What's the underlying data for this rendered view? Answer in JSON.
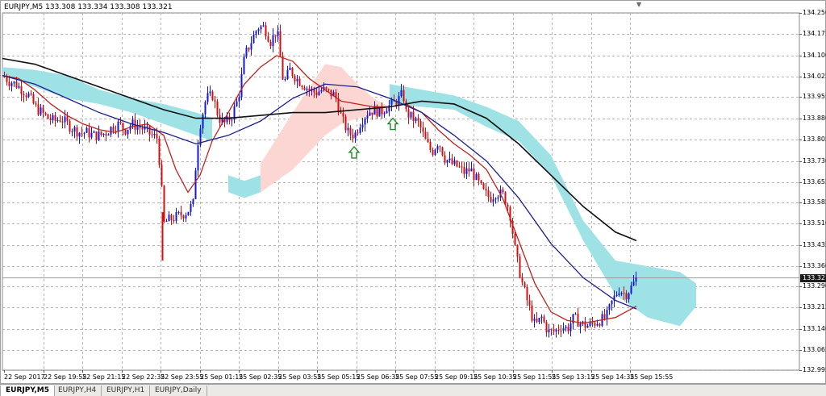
{
  "window": {
    "title": "EURJPY,M5  133.308 133.334 133.308 133.321"
  },
  "current_price": {
    "label": "133.321",
    "value": 133.321
  },
  "tabs": [
    {
      "label": "EURJPY,M5",
      "active": true
    },
    {
      "label": "EURJPY,H4",
      "active": false
    },
    {
      "label": "EURJPY,H1",
      "active": false
    },
    {
      "label": "EURJPY,Daily",
      "active": false
    }
  ],
  "colors": {
    "bull": "#1717d8",
    "bear": "#d01010",
    "ma_fast": "#c0221c",
    "ma_mid": "#1d1d8f",
    "ma_slow": "#101010",
    "cloud_bull": "#9fe2e6",
    "cloud_bear": "#fbd6d2",
    "grid": "#b4b4b4",
    "arrow": "#1e8a28"
  },
  "chart_data": {
    "type": "candlestick",
    "symbol": "EURJPY",
    "timeframe": "M5",
    "ohlc_header": {
      "open": 133.308,
      "high": 133.334,
      "low": 133.308,
      "close": 133.321
    },
    "ylim": [
      132.995,
      134.25
    ],
    "y_ticks": [
      "134.250",
      "134.175",
      "134.100",
      "134.025",
      "133.955",
      "133.880",
      "133.805",
      "133.730",
      "133.655",
      "133.585",
      "133.510",
      "133.435",
      "133.360",
      "133.290",
      "133.215",
      "133.140",
      "133.065",
      "132.995"
    ],
    "x_ticks": [
      "22 Sep 2017",
      "22 Sep 19:55",
      "22 Sep 21:15",
      "22 Sep 22:35",
      "22 Sep 23:55",
      "25 Sep 01:15",
      "25 Sep 02:35",
      "25 Sep 03:55",
      "25 Sep 05:15",
      "25 Sep 06:35",
      "25 Sep 07:55",
      "25 Sep 09:15",
      "25 Sep 10:35",
      "25 Sep 11:55",
      "25 Sep 13:15",
      "25 Sep 14:35",
      "25 Sep 15:55"
    ],
    "close_path": [
      [
        0,
        134.03
      ],
      [
        8,
        134.01
      ],
      [
        16,
        134.0
      ],
      [
        24,
        133.98
      ],
      [
        32,
        133.96
      ],
      [
        40,
        133.92
      ],
      [
        48,
        133.9
      ],
      [
        56,
        133.88
      ],
      [
        64,
        133.87
      ],
      [
        72,
        133.88
      ],
      [
        80,
        133.86
      ],
      [
        88,
        133.84
      ],
      [
        96,
        133.83
      ],
      [
        104,
        133.83
      ],
      [
        112,
        133.82
      ],
      [
        120,
        133.82
      ],
      [
        128,
        133.83
      ],
      [
        136,
        133.85
      ],
      [
        144,
        133.86
      ],
      [
        152,
        133.84
      ],
      [
        160,
        133.86
      ],
      [
        168,
        133.85
      ],
      [
        176,
        133.84
      ],
      [
        184,
        133.82
      ],
      [
        192,
        133.81
      ],
      [
        200,
        133.51
      ],
      [
        204,
        133.52
      ],
      [
        212,
        133.53
      ],
      [
        220,
        133.54
      ],
      [
        228,
        133.55
      ],
      [
        236,
        133.58
      ],
      [
        240,
        133.75
      ],
      [
        244,
        133.85
      ],
      [
        252,
        133.95
      ],
      [
        260,
        133.96
      ],
      [
        268,
        133.88
      ],
      [
        276,
        133.86
      ],
      [
        284,
        133.89
      ],
      [
        292,
        133.95
      ],
      [
        300,
        134.1
      ],
      [
        308,
        134.15
      ],
      [
        316,
        134.2
      ],
      [
        324,
        134.2
      ],
      [
        332,
        134.15
      ],
      [
        340,
        134.19
      ],
      [
        348,
        134.0
      ],
      [
        356,
        134.05
      ],
      [
        364,
        134.02
      ],
      [
        372,
        134.0
      ],
      [
        380,
        133.98
      ],
      [
        388,
        133.97
      ],
      [
        396,
        133.98
      ],
      [
        404,
        133.97
      ],
      [
        412,
        133.96
      ],
      [
        420,
        133.88
      ],
      [
        428,
        133.83
      ],
      [
        436,
        133.82
      ],
      [
        444,
        133.87
      ],
      [
        452,
        133.9
      ],
      [
        460,
        133.91
      ],
      [
        468,
        133.9
      ],
      [
        476,
        133.92
      ],
      [
        484,
        133.93
      ],
      [
        492,
        133.95
      ],
      [
        496,
        133.97
      ],
      [
        500,
        133.9
      ],
      [
        508,
        133.88
      ],
      [
        516,
        133.86
      ],
      [
        524,
        133.8
      ],
      [
        532,
        133.76
      ],
      [
        540,
        133.8
      ],
      [
        548,
        133.74
      ],
      [
        556,
        133.72
      ],
      [
        564,
        133.71
      ],
      [
        572,
        133.69
      ],
      [
        580,
        133.7
      ],
      [
        588,
        133.66
      ],
      [
        596,
        133.62
      ],
      [
        604,
        133.6
      ],
      [
        612,
        133.62
      ],
      [
        620,
        133.61
      ],
      [
        628,
        133.56
      ],
      [
        636,
        133.4
      ],
      [
        644,
        133.3
      ],
      [
        652,
        133.22
      ],
      [
        660,
        133.15
      ],
      [
        668,
        133.18
      ],
      [
        676,
        133.13
      ],
      [
        684,
        133.13
      ],
      [
        692,
        133.15
      ],
      [
        700,
        133.14
      ],
      [
        708,
        133.18
      ],
      [
        716,
        133.16
      ],
      [
        724,
        133.15
      ],
      [
        732,
        133.16
      ],
      [
        740,
        133.17
      ],
      [
        748,
        133.18
      ],
      [
        756,
        133.24
      ],
      [
        764,
        133.28
      ],
      [
        772,
        133.26
      ],
      [
        780,
        133.29
      ],
      [
        786,
        133.321
      ]
    ],
    "series": [
      {
        "name": "MA fast",
        "x": [
          0,
          20,
          40,
          60,
          80,
          100,
          120,
          140,
          160,
          180,
          200,
          215,
          230,
          245,
          260,
          280,
          300,
          320,
          340,
          360,
          380,
          400,
          420,
          440,
          460,
          480,
          500,
          520,
          540,
          560,
          580,
          600,
          620,
          640,
          660,
          680,
          700,
          720,
          740,
          760,
          786
        ],
        "values": [
          134.03,
          134.02,
          133.98,
          133.93,
          133.89,
          133.86,
          133.84,
          133.83,
          133.85,
          133.86,
          133.82,
          133.7,
          133.62,
          133.68,
          133.8,
          133.9,
          134.0,
          134.06,
          134.1,
          134.08,
          134.02,
          133.98,
          133.94,
          133.93,
          133.92,
          133.92,
          133.93,
          133.9,
          133.84,
          133.79,
          133.75,
          133.7,
          133.6,
          133.45,
          133.3,
          133.2,
          133.17,
          133.16,
          133.17,
          133.18,
          133.22
        ]
      },
      {
        "name": "MA mid",
        "x": [
          0,
          40,
          80,
          120,
          160,
          200,
          240,
          280,
          320,
          360,
          400,
          440,
          480,
          520,
          560,
          600,
          640,
          680,
          720,
          760,
          786
        ],
        "values": [
          134.03,
          134.0,
          133.95,
          133.9,
          133.86,
          133.83,
          133.79,
          133.82,
          133.87,
          133.95,
          134.0,
          133.99,
          133.95,
          133.9,
          133.82,
          133.73,
          133.6,
          133.44,
          133.32,
          133.24,
          133.21
        ]
      },
      {
        "name": "MA slow",
        "x": [
          0,
          40,
          80,
          120,
          160,
          200,
          240,
          280,
          320,
          360,
          400,
          440,
          480,
          520,
          560,
          600,
          640,
          680,
          720,
          760,
          786
        ],
        "values": [
          134.09,
          134.07,
          134.03,
          133.99,
          133.95,
          133.91,
          133.88,
          133.88,
          133.89,
          133.9,
          133.9,
          133.91,
          133.92,
          133.94,
          133.93,
          133.88,
          133.79,
          133.68,
          133.57,
          133.48,
          133.45
        ]
      }
    ],
    "cloud": [
      {
        "x": [
          0,
          40,
          80,
          120,
          160,
          200,
          240,
          260
        ],
        "upper": [
          134.06,
          134.05,
          134.03,
          133.98,
          133.95,
          133.93,
          133.9,
          133.88
        ],
        "lower": [
          134.03,
          133.99,
          133.95,
          133.93,
          133.9,
          133.86,
          133.82,
          133.8
        ],
        "color": "bull"
      },
      {
        "x": [
          280,
          300,
          320
        ],
        "upper": [
          133.68,
          133.66,
          133.68
        ],
        "lower": [
          133.62,
          133.6,
          133.62
        ],
        "color": "bull"
      },
      {
        "x": [
          320,
          360,
          400,
          420,
          440,
          460,
          480
        ],
        "upper": [
          133.72,
          133.9,
          134.07,
          134.06,
          134.0,
          133.95,
          133.92
        ],
        "lower": [
          133.62,
          133.7,
          133.82,
          133.86,
          133.88,
          133.89,
          133.9
        ],
        "color": "bear"
      },
      {
        "x": [
          480,
          520,
          560,
          600,
          640,
          680,
          720,
          760,
          800,
          840,
          860
        ],
        "upper": [
          134.0,
          133.98,
          133.96,
          133.92,
          133.87,
          133.75,
          133.52,
          133.38,
          133.36,
          133.34,
          133.3
        ],
        "lower": [
          133.93,
          133.92,
          133.91,
          133.85,
          133.8,
          133.68,
          133.45,
          133.26,
          133.18,
          133.15,
          133.22
        ],
        "color": "bull"
      }
    ],
    "arrows": [
      {
        "x": 436,
        "value": 133.78,
        "direction": "up"
      },
      {
        "x": 484,
        "value": 133.88,
        "direction": "up"
      }
    ],
    "grid": true
  }
}
